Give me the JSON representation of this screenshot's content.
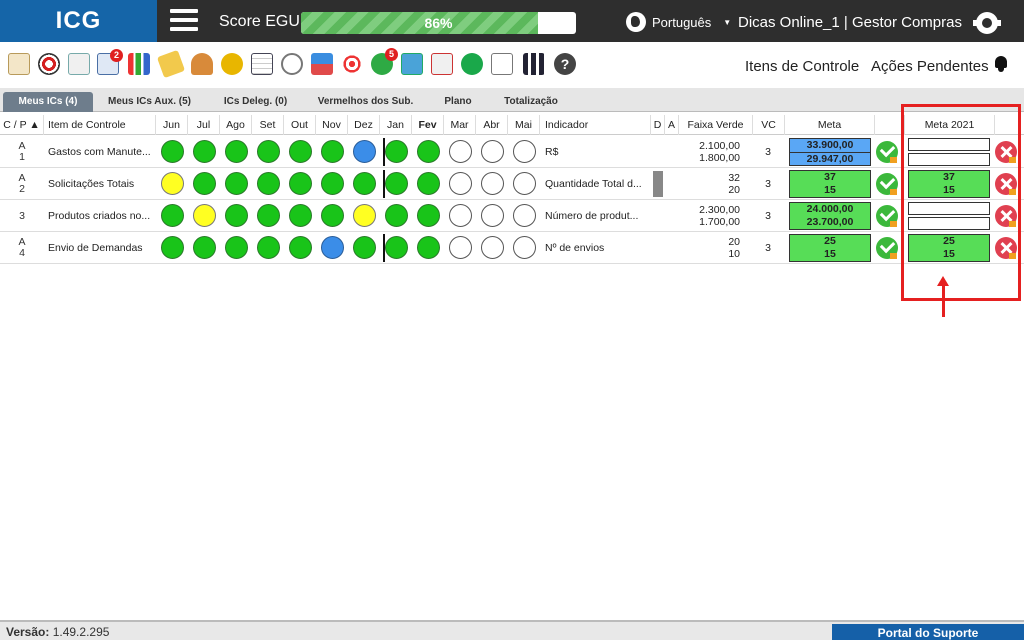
{
  "app": {
    "logo": "ICG",
    "score_label": "Score EGU:",
    "score_value": "86%",
    "score_progress": 0.86,
    "language": "Português",
    "user_info": "Dicas Online_1  |  Gestor Compras"
  },
  "toolbar": {
    "badges": {
      "b1": "2",
      "b2": "5"
    },
    "links": {
      "itens": "Itens de Controle",
      "acoes": "Ações Pendentes"
    }
  },
  "tabs": [
    {
      "label": "Meus ICs (4)"
    },
    {
      "label": "Meus ICs Aux. (5)"
    },
    {
      "label": "ICs Deleg. (0)"
    },
    {
      "label": "Vermelhos dos Sub."
    },
    {
      "label": "Plano"
    },
    {
      "label": "Totalização"
    }
  ],
  "headers": {
    "cp": "C / P",
    "item": "Item de Controle",
    "months": [
      "Jun",
      "Jul",
      "Ago",
      "Set",
      "Out",
      "Nov",
      "Dez",
      "Jan",
      "Fev",
      "Mar",
      "Abr",
      "Mai"
    ],
    "indicador": "Indicador",
    "d": "D",
    "a": "A",
    "faixa": "Faixa Verde",
    "vc": "VC",
    "meta": "Meta",
    "meta2021": "Meta 2021"
  },
  "rows": [
    {
      "cp1": "A",
      "cp2": "1",
      "item": "Gastos com Manute...",
      "status": [
        "green",
        "green",
        "green",
        "green",
        "green",
        "green",
        "blue",
        "green",
        "green",
        "empty",
        "empty",
        "empty"
      ],
      "indicador": "R$",
      "faixa1": "2.100,00",
      "faixa2": "1.800,00",
      "vc": "3",
      "meta1": "33.900,00",
      "meta2": "29.947,00",
      "meta_style": "blue",
      "m21_1": "",
      "m21_2": "",
      "m21_style": "empty"
    },
    {
      "cp1": "A",
      "cp2": "2",
      "item": "Solicitações Totais",
      "status": [
        "yellow",
        "green",
        "green",
        "green",
        "green",
        "green",
        "green",
        "green",
        "green",
        "empty",
        "empty",
        "empty"
      ],
      "indicador": "Quantidade Total d...",
      "faixa1": "32",
      "faixa2": "20",
      "vc": "3",
      "meta1": "37",
      "meta2": "15",
      "meta_style": "green",
      "m21_1": "37",
      "m21_2": "15",
      "m21_style": "green"
    },
    {
      "cp1": "",
      "cp2": "3",
      "item": "Produtos criados no...",
      "status": [
        "green",
        "yellow",
        "green",
        "green",
        "green",
        "green",
        "yellow",
        "green",
        "green",
        "empty",
        "empty",
        "empty"
      ],
      "indicador": "Número de produt...",
      "faixa1": "2.300,00",
      "faixa2": "1.700,00",
      "vc": "3",
      "meta1": "24.000,00",
      "meta2": "23.700,00",
      "meta_style": "green",
      "m21_1": "",
      "m21_2": "",
      "m21_style": "empty"
    },
    {
      "cp1": "A",
      "cp2": "4",
      "item": "Envio de Demandas",
      "status": [
        "green",
        "green",
        "green",
        "green",
        "green",
        "blue",
        "green",
        "green",
        "green",
        "empty",
        "empty",
        "empty"
      ],
      "indicador": "Nº de envios",
      "faixa1": "20",
      "faixa2": "10",
      "vc": "3",
      "meta1": "25",
      "meta2": "15",
      "meta_style": "green",
      "m21_1": "25",
      "m21_2": "15",
      "m21_style": "green"
    }
  ],
  "footer": {
    "version_label": "Versão:",
    "version_value": "1.49.2.295",
    "portal": "Portal do Suporte"
  }
}
